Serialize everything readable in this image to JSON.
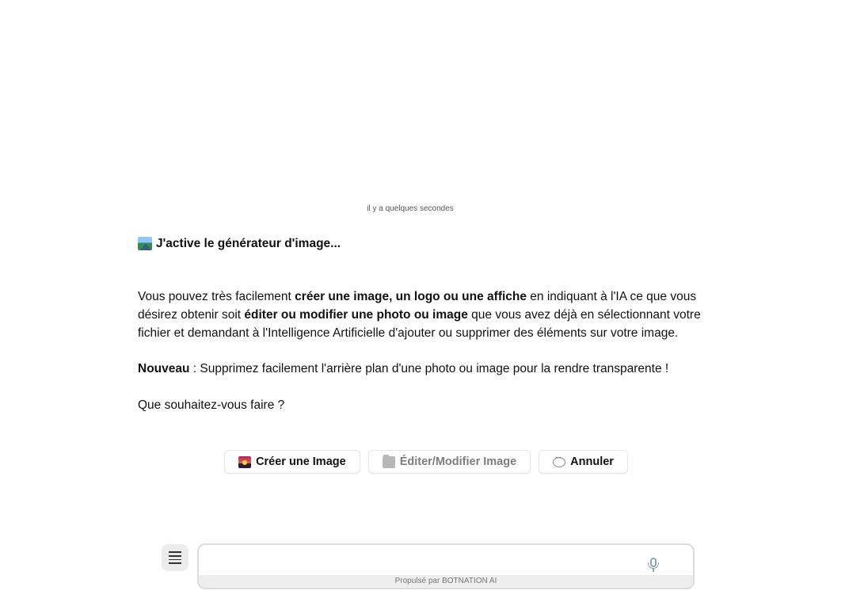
{
  "chat": {
    "timestamp": "il y a quelques secondes",
    "title": "J'active le générateur d'image...",
    "body": {
      "p1_a": "Vous pouvez très facilement ",
      "p1_b": "créer une image, un logo ou une affiche",
      "p1_c": " en indiquant à l'IA ce que vous désirez obtenir soit ",
      "p1_d": "éditer ou modifier une photo ou image",
      "p1_e": " que vous avez déjà en sélectionnant votre fichier et demandant à l'Intelligence Artificielle d'ajouter ou supprimer des éléments sur votre image."
    },
    "new_label": "Nouveau",
    "new_text": " : Supprimez facilement l'arrière plan d'une photo ou image pour la rendre transparente !",
    "question": "Que souhaitez-vous faire ?"
  },
  "choices": [
    {
      "label": "Créer une Image",
      "icon": "sunset-icon"
    },
    {
      "label": "Éditer/Modifier Image",
      "icon": "folder-icon"
    },
    {
      "label": "Annuler",
      "icon": "speech-bubble-icon"
    }
  ],
  "composer": {
    "placeholder": "",
    "value": "",
    "powered_by": "Propulsé par BOTNATION AI",
    "menu_icon": "hamburger-menu-icon",
    "mic_icon": "microphone-icon"
  }
}
